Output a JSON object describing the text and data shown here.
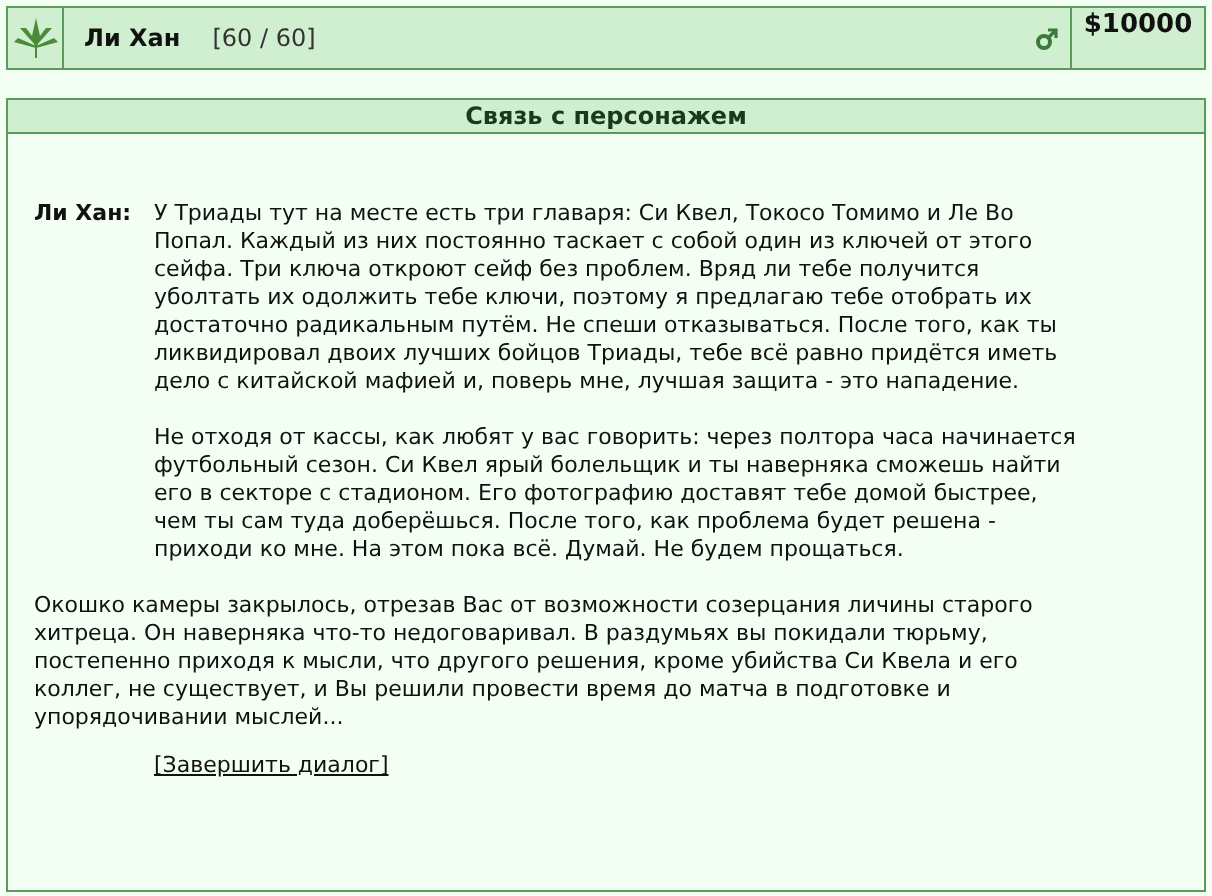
{
  "top_bar": {
    "name": "Ли Хан",
    "health": "[60 / 60]",
    "money": "$10000"
  },
  "dialog": {
    "title": "Связь с персонажем",
    "speaker": "Ли Хан:",
    "paragraphs": [
      "У Триады тут на месте есть три главаря: Си Квел, Токосо Томимо и Ле Во Попал. Каждый из них постоянно таскает с собой один из ключей от этого сейфа. Три ключа откроют сейф без проблем. Вряд ли тебе получится уболтать их одолжить тебе ключи, поэтому я предлагаю тебе отобрать их достаточно радикальным путём. Не спеши отказываться. После того, как ты ликвидировал двоих лучших бойцов Триады, тебе всё равно придётся иметь дело с китайской мафией и, поверь мне, лучшая защита - это нападение.",
      "Не отходя от кассы, как любят у вас говорить: через полтора часа начинается футбольный сезон. Си Квел ярый болельщик и ты наверняка сможешь найти его в секторе с стадионом. Его фотографию доставят тебе домой быстрее, чем ты сам туда доберёшься. После того, как проблема будет решена - приходи ко мне. На этом пока всё. Думай. Не будем прощаться."
    ],
    "narration": "Окошко камеры закрылось, отрезав Вас от возможности созерцания личины старого хитреца. Он наверняка что-то недоговаривал. В раздумьях вы покидали тюрьму, постепенно приходя к мысли, что другого решения, кроме убийства Си Квела и его коллег, не существует, и Вы решили провести время до матча в подготовке и упорядочивании мыслей...",
    "end_link": "[Завершить диалог]"
  }
}
